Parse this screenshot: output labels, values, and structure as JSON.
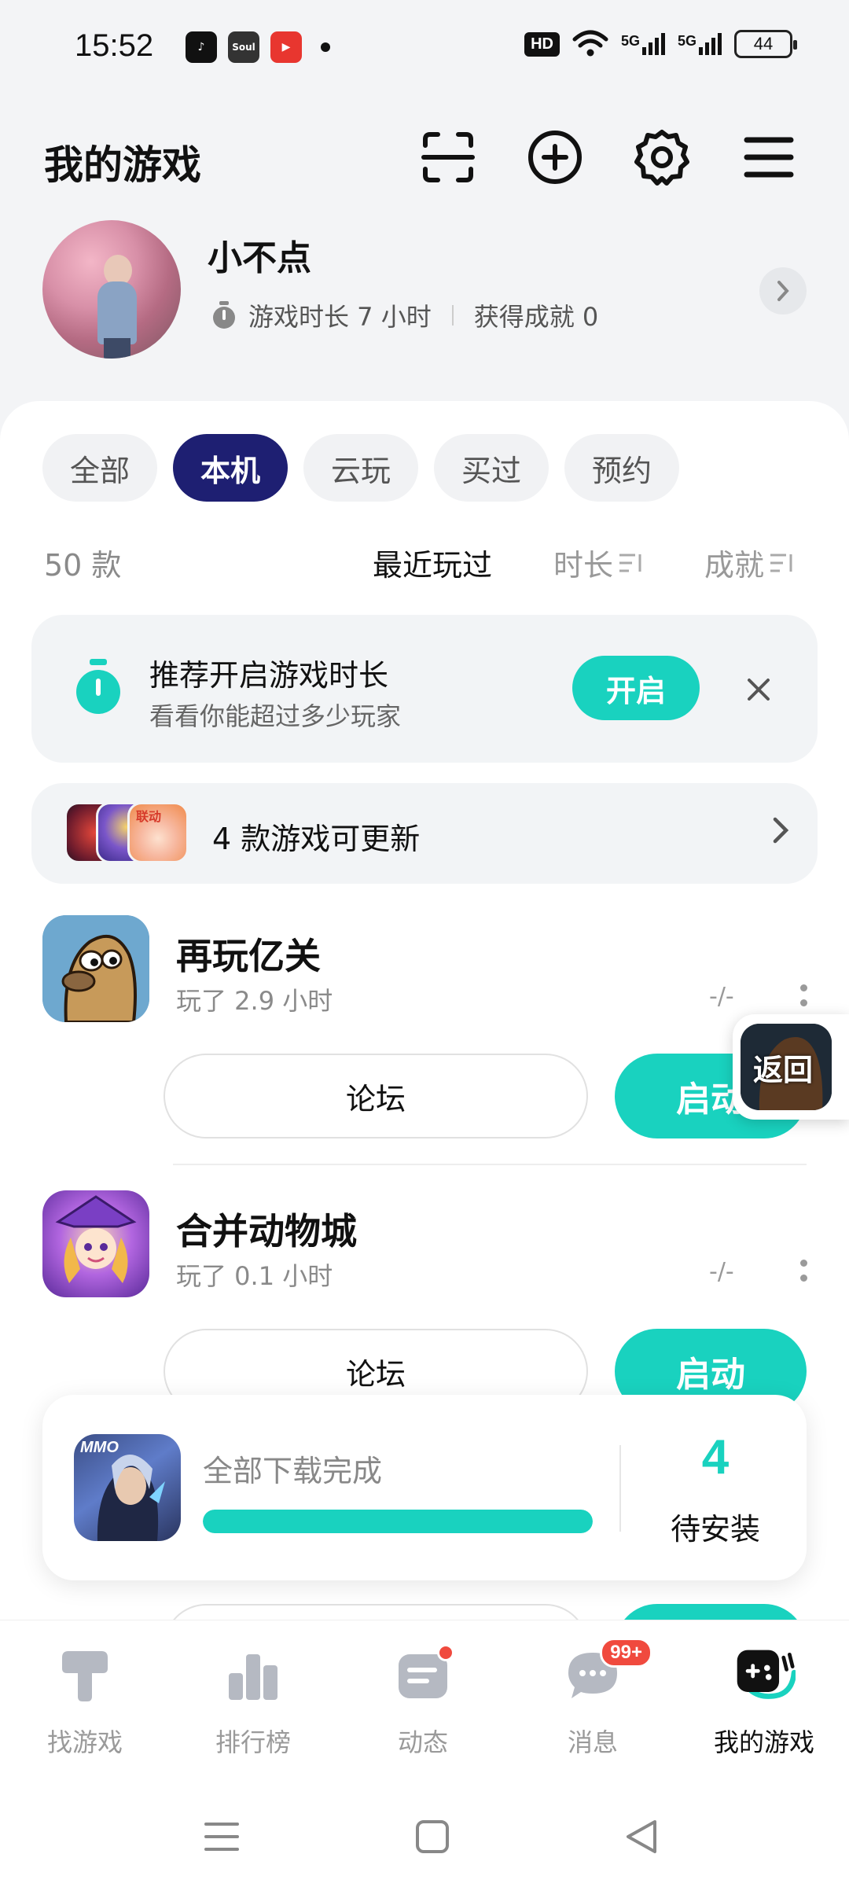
{
  "status_bar": {
    "time": "15:52",
    "apps": [
      "TikTok",
      "Soul",
      "快"
    ],
    "hd_label": "HD",
    "network_1": "5G",
    "network_2": "5G",
    "battery": "44"
  },
  "header": {
    "title": "我的游戏",
    "icons": [
      "scan-icon",
      "add-circle-icon",
      "settings-icon",
      "menu-icon"
    ]
  },
  "profile": {
    "name": "小不点",
    "playtime": "游戏时长 7 小时",
    "achievements": "获得成就 0"
  },
  "tabs": [
    {
      "label": "全部",
      "active": false
    },
    {
      "label": "本机",
      "active": true
    },
    {
      "label": "云玩",
      "active": false
    },
    {
      "label": "买过",
      "active": false
    },
    {
      "label": "预约",
      "active": false
    }
  ],
  "list_header": {
    "count": "50 款",
    "sort_recent": "最近玩过",
    "sort_duration": "时长",
    "sort_achievement": "成就"
  },
  "recommend": {
    "title": "推荐开启游戏时长",
    "subtitle": "看看你能超过多少玩家",
    "button": "开启"
  },
  "updates": {
    "text": "4 款游戏可更新",
    "badge_text": "联动"
  },
  "games": [
    {
      "name": "再玩亿关",
      "played": "玩了 2.9 小时",
      "rating": "-/-",
      "forum_label": "论坛",
      "launch_label": "启动"
    },
    {
      "name": "合并动物城",
      "played": "玩了 0.1 小时",
      "rating": "-/-",
      "forum_label": "论坛",
      "launch_label": "启动"
    }
  ],
  "float_return": {
    "label": "返回"
  },
  "download": {
    "title": "全部下载完成",
    "progress": 1.0,
    "count": "4",
    "label": "待安装",
    "icon_text": "MMO"
  },
  "bottom_nav": [
    {
      "label": "找游戏",
      "active": false
    },
    {
      "label": "排行榜",
      "active": false
    },
    {
      "label": "动态",
      "active": false
    },
    {
      "label": "消息",
      "active": false,
      "badge": "99+"
    },
    {
      "label": "我的游戏",
      "active": true
    }
  ],
  "colors": {
    "accent": "#19d2bf",
    "tab_active": "#1e1f72",
    "badge_red": "#f04a3e"
  }
}
